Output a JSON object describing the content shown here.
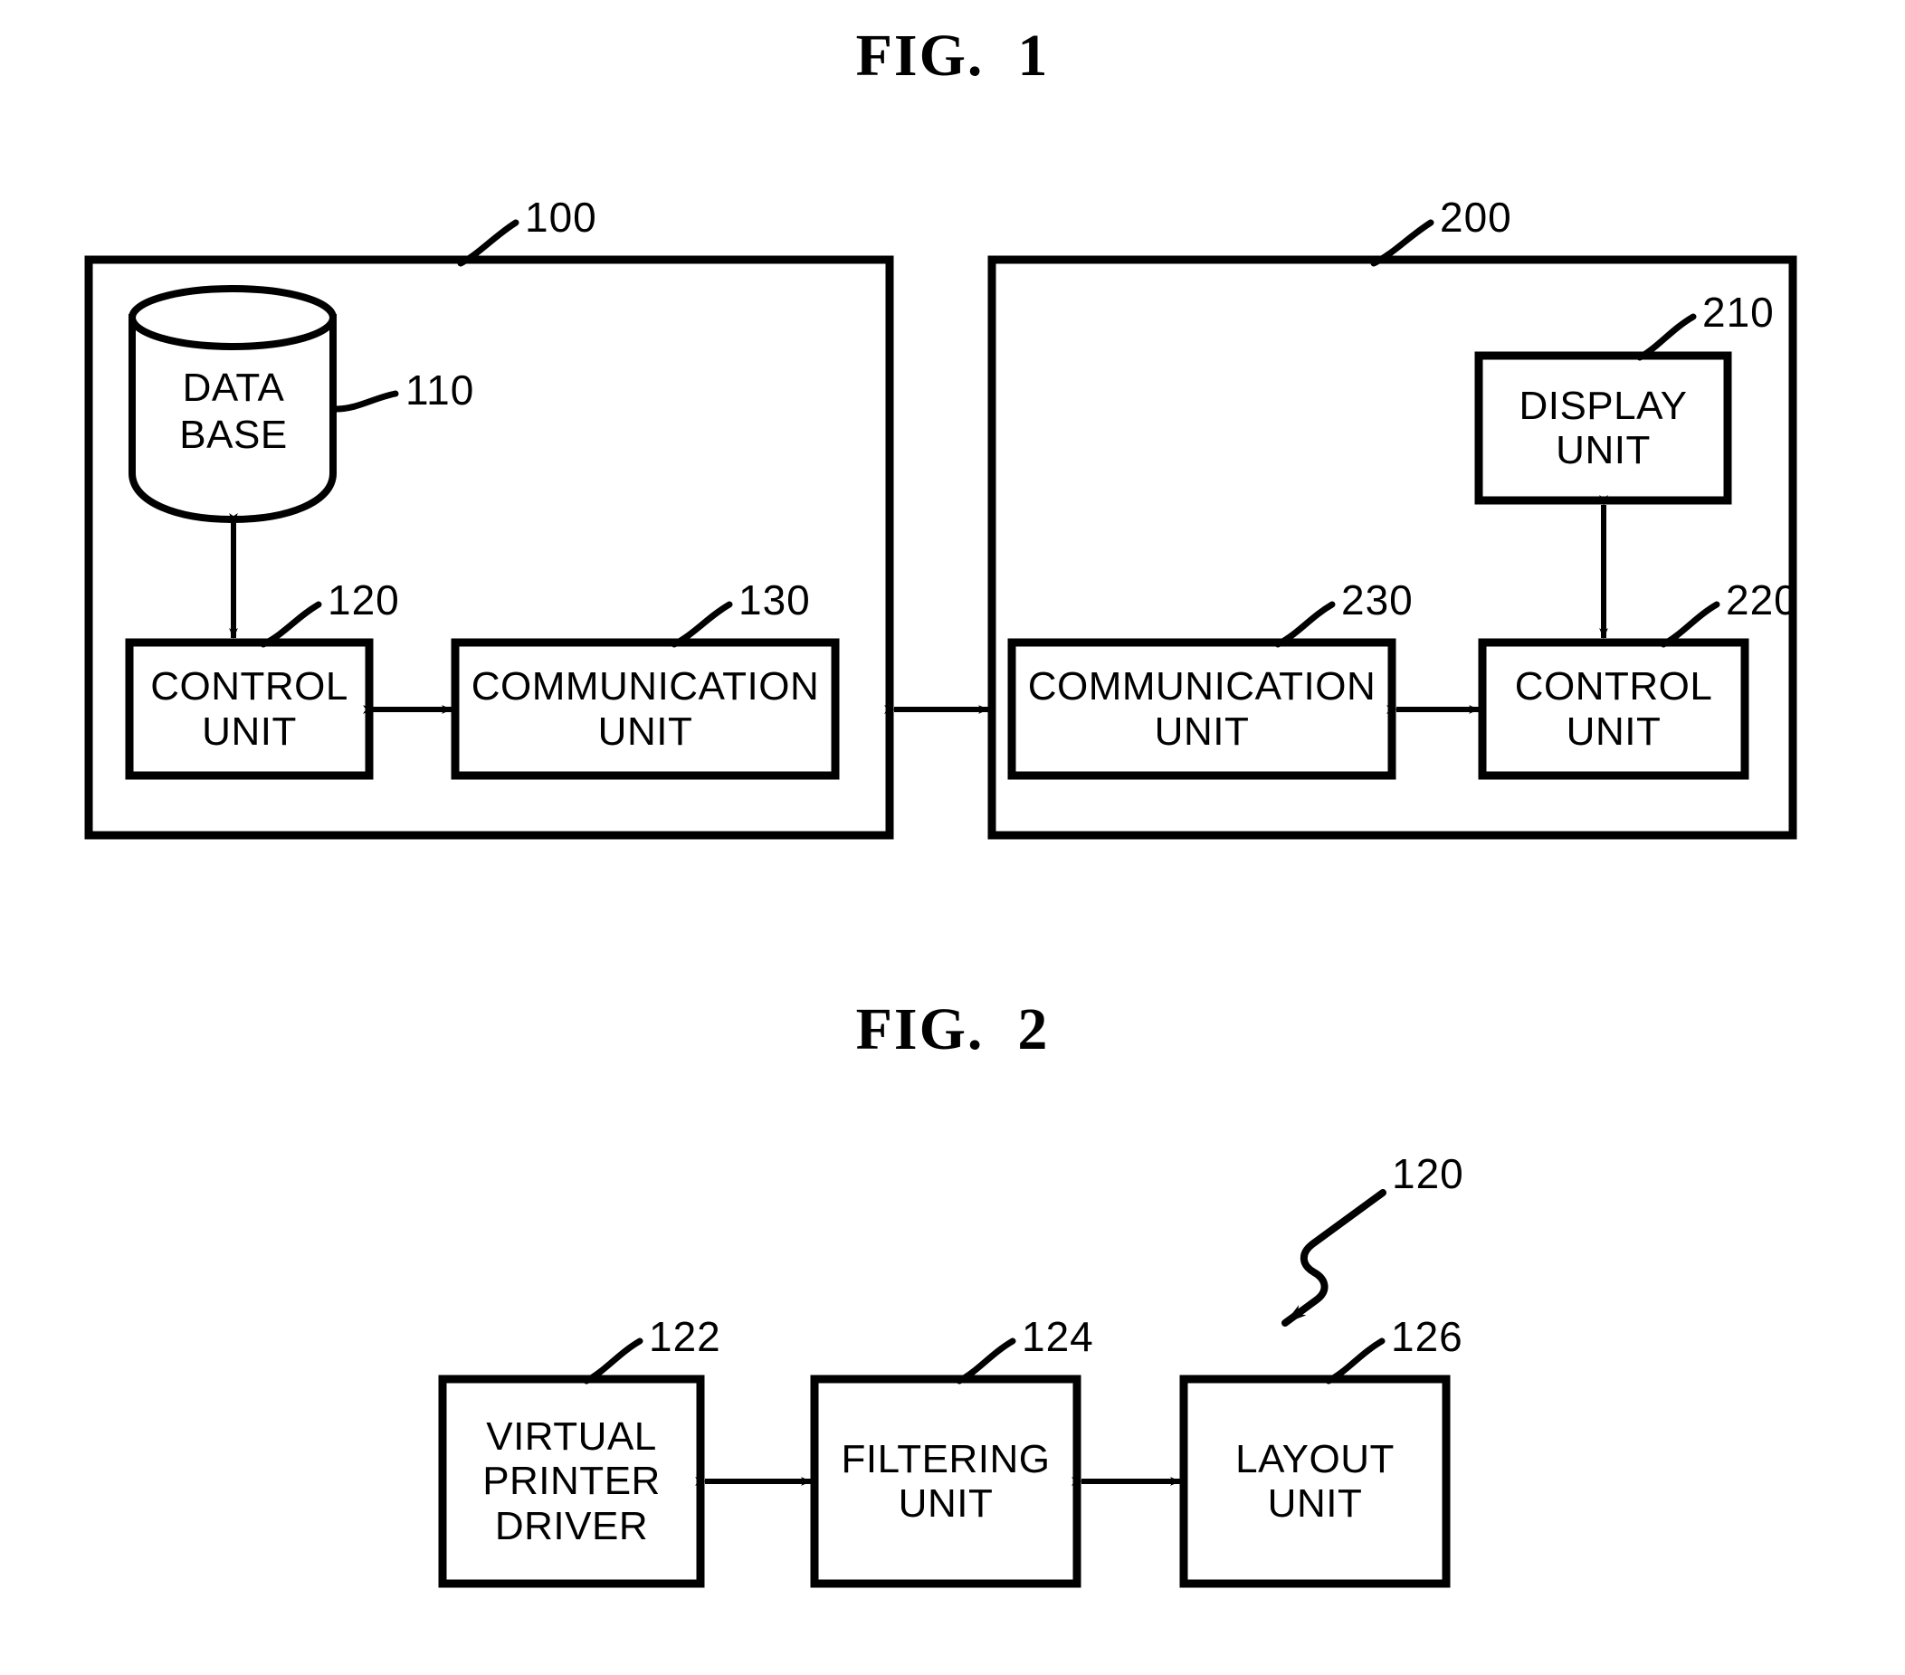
{
  "figures": [
    {
      "id": "fig1",
      "title": "FIG.  1",
      "panels": [
        {
          "ref": "100",
          "nodes": [
            {
              "ref": "110",
              "label": "DATA\nBASE",
              "shape": "cylinder",
              "name": "database"
            },
            {
              "ref": "120",
              "label": "CONTROL\nUNIT",
              "shape": "rect",
              "name": "control-unit"
            },
            {
              "ref": "130",
              "label": "COMMUNICATION\nUNIT",
              "shape": "rect",
              "name": "communication-unit"
            }
          ]
        },
        {
          "ref": "200",
          "nodes": [
            {
              "ref": "210",
              "label": "DISPLAY\nUNIT",
              "shape": "rect",
              "name": "display-unit"
            },
            {
              "ref": "220",
              "label": "CONTROL\nUNIT",
              "shape": "rect",
              "name": "control-unit"
            },
            {
              "ref": "230",
              "label": "COMMUNICATION\nUNIT",
              "shape": "rect",
              "name": "communication-unit"
            }
          ]
        }
      ]
    },
    {
      "id": "fig2",
      "title": "FIG.  2",
      "ref": "120",
      "nodes": [
        {
          "ref": "122",
          "label": "VIRTUAL\nPRINTER\nDRIVER",
          "shape": "rect",
          "name": "virtual-printer-driver"
        },
        {
          "ref": "124",
          "label": "FILTERING\nUNIT",
          "shape": "rect",
          "name": "filtering-unit"
        },
        {
          "ref": "126",
          "label": "LAYOUT\nUNIT",
          "shape": "rect",
          "name": "layout-unit"
        }
      ]
    }
  ],
  "labels": {
    "fig1_title": "FIG.  1",
    "fig2_title": "FIG.  2",
    "panel_100_ref": "100",
    "panel_200_ref": "200",
    "database_ref": "110",
    "database_text_line1": "DATA",
    "database_text_line2": "BASE",
    "control_unit_100_ref": "120",
    "control_unit_100_line1": "CONTROL",
    "control_unit_100_line2": "UNIT",
    "communication_unit_100_ref": "130",
    "communication_unit_100_line1": "COMMUNICATION",
    "communication_unit_100_line2": "UNIT",
    "display_unit_ref": "210",
    "display_unit_line1": "DISPLAY",
    "display_unit_line2": "UNIT",
    "control_unit_200_ref": "220",
    "control_unit_200_line1": "CONTROL",
    "control_unit_200_line2": "UNIT",
    "communication_unit_200_ref": "230",
    "communication_unit_200_line1": "COMMUNICATION",
    "communication_unit_200_line2": "UNIT",
    "fig2_block_ref": "120",
    "virtual_printer_driver_ref": "122",
    "virtual_printer_driver_line1": "VIRTUAL",
    "virtual_printer_driver_line2": "PRINTER",
    "virtual_printer_driver_line3": "DRIVER",
    "filtering_unit_ref": "124",
    "filtering_unit_line1": "FILTERING",
    "filtering_unit_line2": "UNIT",
    "layout_unit_ref": "126",
    "layout_unit_line1": "LAYOUT",
    "layout_unit_line2": "UNIT"
  },
  "colors": {
    "ink": "#000000",
    "paper": "#ffffff"
  }
}
